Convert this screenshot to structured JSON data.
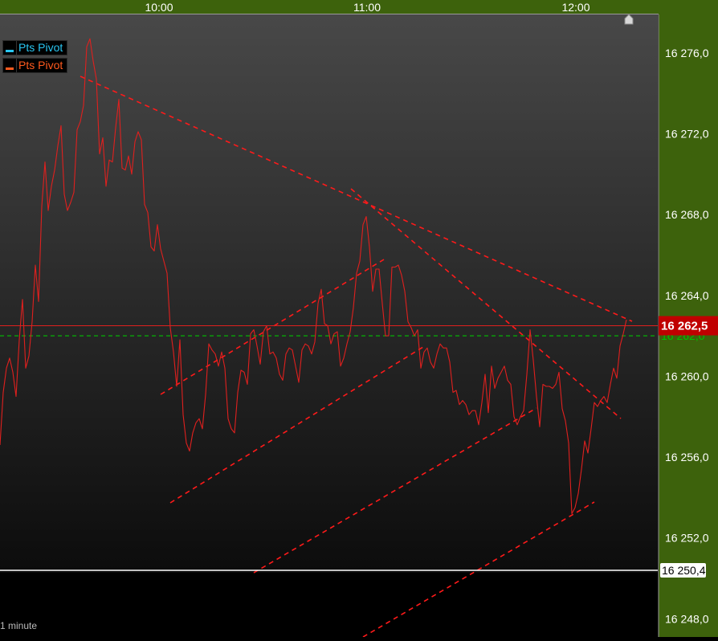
{
  "chart_data": {
    "type": "line",
    "title": "",
    "x_ticks": [
      "10:00",
      "11:00",
      "12:00"
    ],
    "y_ticks": [
      "16 276,0",
      "16 272,0",
      "16 268,0",
      "16 264,0",
      "16 260,0",
      "16 256,0",
      "16 252,0",
      "16 248,0"
    ],
    "ylim": [
      16247.1,
      16277.9
    ],
    "legend": [
      {
        "label": "Pts Pivot",
        "color": "#29c6f2"
      },
      {
        "label": "Pts Pivot",
        "color": "#ff5a1e"
      }
    ],
    "series": [
      {
        "color": "#e0201e",
        "time_x": [
          0,
          4,
          8,
          12,
          16,
          20,
          24,
          28,
          32,
          36,
          40,
          44,
          48,
          52,
          56,
          60,
          64,
          68,
          72,
          76,
          80,
          84,
          88,
          92,
          96,
          100,
          104,
          108,
          112,
          116,
          120,
          124,
          128,
          132,
          136,
          140,
          144,
          148,
          152,
          156,
          160,
          164,
          168,
          172,
          176,
          180,
          184,
          188,
          192,
          196,
          200,
          204,
          208,
          212,
          216,
          220,
          224,
          228,
          232,
          236,
          240,
          244,
          248,
          252,
          256,
          260,
          264,
          268,
          272,
          276,
          280,
          284,
          288,
          292,
          296,
          300,
          304,
          308,
          312,
          316,
          320,
          324,
          328,
          332,
          336,
          340,
          344,
          348,
          352,
          356,
          360,
          364,
          368,
          372,
          376,
          380,
          384,
          388,
          392,
          396,
          400,
          404,
          408,
          412,
          416,
          420,
          424,
          428,
          432,
          436,
          440,
          444,
          448,
          452,
          456,
          460,
          464,
          468,
          472,
          476,
          480,
          484,
          488,
          492,
          496,
          500,
          504,
          508,
          512,
          516,
          520,
          524,
          528,
          532,
          536,
          540,
          544,
          548,
          552,
          556,
          560,
          564,
          568,
          572,
          576,
          580,
          584,
          588,
          592,
          596,
          600,
          604,
          608,
          612,
          616,
          620,
          624,
          628,
          632,
          636,
          640,
          644,
          648,
          652,
          656,
          660,
          664,
          668,
          672,
          676,
          680,
          684,
          688,
          692,
          696,
          700,
          704,
          708,
          712,
          716,
          720,
          724,
          728,
          732,
          736,
          740,
          744,
          748,
          752,
          756,
          760,
          764,
          768,
          772,
          776,
          780
        ],
        "values": [
          16256.6,
          16259.2,
          16260.4,
          16260.9,
          16260.2,
          16259.0,
          16261.8,
          16263.8,
          16260.4,
          16261.0,
          16262.7,
          16265.5,
          16263.7,
          16268.4,
          16270.6,
          16268.2,
          16269.4,
          16270.2,
          16271.4,
          16272.4,
          16269.0,
          16268.2,
          16268.6,
          16269.1,
          16272.2,
          16272.6,
          16273.4,
          16276.3,
          16276.7,
          16275.6,
          16274.7,
          16271.0,
          16271.8,
          16269.4,
          16270.7,
          16270.6,
          16272.3,
          16273.7,
          16270.3,
          16270.2,
          16270.9,
          16270.0,
          16271.6,
          16272.1,
          16271.7,
          16268.5,
          16268.1,
          16266.4,
          16266.2,
          16267.5,
          16266.3,
          16265.7,
          16265.1,
          16262.4,
          16261.2,
          16259.5,
          16261.8,
          16258.1,
          16256.7,
          16256.3,
          16257.2,
          16257.7,
          16257.9,
          16257.4,
          16259.1,
          16261.6,
          16261.3,
          16261.1,
          16260.5,
          16261.2,
          16260.4,
          16257.9,
          16257.4,
          16257.2,
          16259.2,
          16260.3,
          16260.2,
          16259.6,
          16262.1,
          16262.3,
          16261.5,
          16260.6,
          16262.2,
          16262.5,
          16261.1,
          16261.2,
          16260.9,
          16260.1,
          16259.8,
          16261.1,
          16261.4,
          16261.3,
          16260.5,
          16259.7,
          16261.3,
          16261.6,
          16261.5,
          16261.1,
          16261.7,
          16263.6,
          16264.3,
          16262.6,
          16262.5,
          16261.6,
          16262.1,
          16262.2,
          16260.5,
          16260.9,
          16261.6,
          16262.2,
          16263.4,
          16265.1,
          16265.7,
          16267.5,
          16267.9,
          16266.4,
          16264.2,
          16265.3,
          16265.3,
          16263.6,
          16262.0,
          16262.0,
          16265.4,
          16265.4,
          16265.5,
          16265.0,
          16264.2,
          16262.7,
          16262.4,
          16262.0,
          16262.3,
          16260.4,
          16261.2,
          16261.4,
          16260.7,
          16260.4,
          16261.1,
          16261.6,
          16261.4,
          16261.4,
          16260.7,
          16259.2,
          16259.3,
          16258.6,
          16258.8,
          16258.6,
          16258.1,
          16258.3,
          16258.3,
          16257.6,
          16258.7,
          16260.1,
          16258.2,
          16260.5,
          16259.4,
          16259.9,
          16260.2,
          16260.5,
          16259.8,
          16259.6,
          16258.0,
          16257.6,
          16258.0,
          16258.3,
          16260.1,
          16262.3,
          16260.8,
          16259.0,
          16257.5,
          16259.6,
          16259.5,
          16259.5,
          16259.4,
          16259.6,
          16260.2,
          16258.4,
          16257.8,
          16256.7,
          16253.2,
          16253.5,
          16254.2,
          16255.4,
          16256.8,
          16256.2,
          16257.4,
          16258.7,
          16258.5,
          16258.8,
          16259.0,
          16258.7,
          16259.6,
          16260.4,
          16259.9,
          16261.5,
          16262.1,
          16262.8
        ]
      }
    ],
    "price_label": {
      "text": "16 262,5",
      "value": 16262.5,
      "bg": "#c00000"
    },
    "green_level": {
      "text": "16 262,0",
      "value": 16262.0,
      "color": "#00c000"
    },
    "white_level": {
      "text": "16 250,4",
      "value": 16250.4
    },
    "timeframe_text": "1 minute",
    "colors": {
      "axis_bg": "#3d620c",
      "price_line": "#e0201e",
      "trendline": "#ff1a1a",
      "plot_top": "#484848",
      "plot_bottom": "#0c0c0c"
    }
  }
}
